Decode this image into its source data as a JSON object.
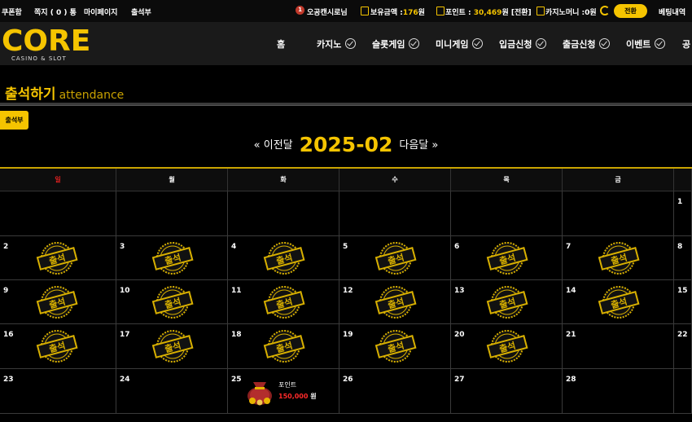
{
  "topbar": {
    "coupon": "쿠폰함",
    "message_label": "쪽지",
    "message_count": "( 0 )",
    "message_unit": "통",
    "mypage": "마이페이지",
    "attendance": "출석부",
    "user_level": "1",
    "user_name": "오공캔시로님",
    "balance_label": "보유금액 :",
    "balance_value": "176",
    "balance_unit": "원",
    "point_label": "포인트 :",
    "point_value": "30,469",
    "point_unit": "원",
    "point_convert": "[전환]",
    "casino_label": "카지노머니 :",
    "casino_value": "0",
    "casino_unit": "원",
    "convert_button": "전환",
    "bet_history": "베팅내역"
  },
  "header": {
    "logo_text": "CORE",
    "logo_sub": "CASINO & SLOT",
    "nav": [
      {
        "label": "홈",
        "check": false
      },
      {
        "label": "카지노",
        "check": true
      },
      {
        "label": "슬롯게임",
        "check": true
      },
      {
        "label": "미니게임",
        "check": true
      },
      {
        "label": "입금신청",
        "check": true
      },
      {
        "label": "출금신청",
        "check": true
      },
      {
        "label": "이벤트",
        "check": true
      },
      {
        "label": "공",
        "check": false
      }
    ]
  },
  "section": {
    "title_ko": "출석하기",
    "title_en": "attendance",
    "book_button": "출석부"
  },
  "month_nav": {
    "prev": "« 이전달",
    "title": "2025-02",
    "next": "다음달 »"
  },
  "calendar": {
    "weekdays": [
      "일",
      "월",
      "화",
      "수",
      "목",
      "금",
      ""
    ],
    "weekday_colors": [
      "#e02020",
      "#ffffff",
      "#ffffff",
      "#ffffff",
      "#ffffff",
      "#ffffff",
      "#ffffff"
    ],
    "stamp_text": "출석",
    "weeks": [
      [
        {
          "n": ""
        },
        {
          "n": ""
        },
        {
          "n": ""
        },
        {
          "n": ""
        },
        {
          "n": ""
        },
        {
          "n": ""
        },
        {
          "n": "1"
        }
      ],
      [
        {
          "n": "2",
          "stamp": true
        },
        {
          "n": "3",
          "stamp": true
        },
        {
          "n": "4",
          "stamp": true
        },
        {
          "n": "5",
          "stamp": true
        },
        {
          "n": "6",
          "stamp": true
        },
        {
          "n": "7",
          "stamp": true
        },
        {
          "n": "8"
        }
      ],
      [
        {
          "n": "9",
          "stamp": true
        },
        {
          "n": "10",
          "stamp": true
        },
        {
          "n": "11",
          "stamp": true
        },
        {
          "n": "12",
          "stamp": true
        },
        {
          "n": "13",
          "stamp": true
        },
        {
          "n": "14",
          "stamp": true
        },
        {
          "n": "15"
        }
      ],
      [
        {
          "n": "16",
          "stamp": true
        },
        {
          "n": "17",
          "stamp": true
        },
        {
          "n": "18",
          "stamp": true
        },
        {
          "n": "19",
          "stamp": true
        },
        {
          "n": "20",
          "stamp": true
        },
        {
          "n": "21"
        },
        {
          "n": "22"
        }
      ],
      [
        {
          "n": "23"
        },
        {
          "n": "24"
        },
        {
          "n": "25",
          "reward": {
            "label": "포인트",
            "amount": "150,000",
            "unit": "원"
          }
        },
        {
          "n": "26"
        },
        {
          "n": "27"
        },
        {
          "n": "28"
        },
        {
          "n": ""
        }
      ]
    ]
  },
  "colors": {
    "accent": "#f5c400",
    "sunday": "#e02020",
    "reward_amount": "#ff2a2a"
  }
}
